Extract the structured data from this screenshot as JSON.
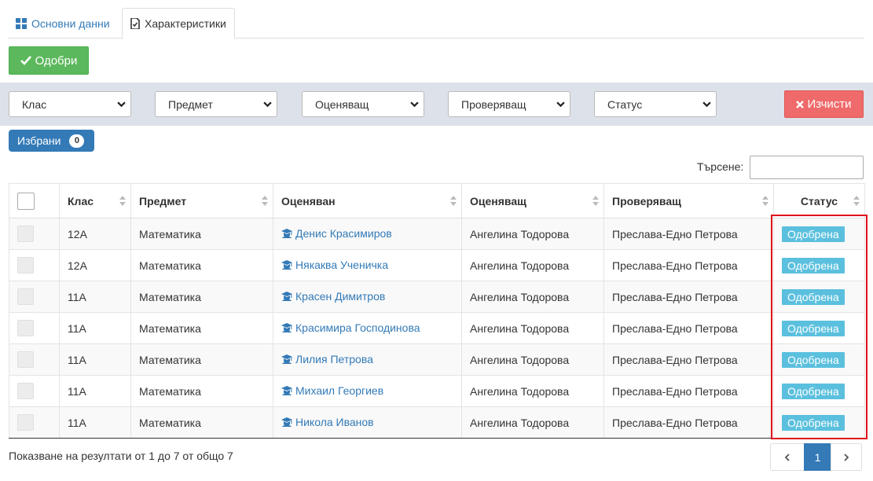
{
  "tabs": [
    {
      "label": "Основни данни",
      "icon": "grid-icon"
    },
    {
      "label": "Характеристики",
      "icon": "document-icon"
    }
  ],
  "toolbar": {
    "approve_label": "Одобри"
  },
  "filters": {
    "class": "Клас",
    "subject": "Предмет",
    "evaluator": "Оценяващ",
    "checker": "Проверяващ",
    "status": "Статус",
    "clear_label": "Изчисти"
  },
  "selected": {
    "label": "Избрани",
    "count": "0"
  },
  "search": {
    "label": "Търсене:",
    "value": ""
  },
  "table": {
    "headers": [
      "Клас",
      "Предмет",
      "Оценяван",
      "Оценяващ",
      "Проверяващ",
      "Статус"
    ],
    "rows": [
      {
        "class": "12А",
        "subject": "Математика",
        "student": "Денис Красимиров",
        "evaluator": "Ангелина Тодорова",
        "checker": "Преслава-Едно Петрова",
        "status": "Одобрена"
      },
      {
        "class": "12А",
        "subject": "Математика",
        "student": "Някаква Ученичка",
        "evaluator": "Ангелина Тодорова",
        "checker": "Преслава-Едно Петрова",
        "status": "Одобрена"
      },
      {
        "class": "11А",
        "subject": "Математика",
        "student": "Красен Димитров",
        "evaluator": "Ангелина Тодорова",
        "checker": "Преслава-Едно Петрова",
        "status": "Одобрена"
      },
      {
        "class": "11А",
        "subject": "Математика",
        "student": "Красимира Господинова",
        "evaluator": "Ангелина Тодорова",
        "checker": "Преслава-Едно Петрова",
        "status": "Одобрена"
      },
      {
        "class": "11А",
        "subject": "Математика",
        "student": "Лилия Петрова",
        "evaluator": "Ангелина Тодорова",
        "checker": "Преслава-Едно Петрова",
        "status": "Одобрена"
      },
      {
        "class": "11А",
        "subject": "Математика",
        "student": "Михаил Георгиев",
        "evaluator": "Ангелина Тодорова",
        "checker": "Преслава-Едно Петрова",
        "status": "Одобрена"
      },
      {
        "class": "11А",
        "subject": "Математика",
        "student": "Никола Иванов",
        "evaluator": "Ангелина Тодорова",
        "checker": "Преслава-Едно Петрова",
        "status": "Одобрена"
      }
    ]
  },
  "footer": {
    "summary": "Показване на резултати от 1 до 7 от общо 7",
    "current_page": "1"
  },
  "colors": {
    "approve": "#5cb85c",
    "clear": "#ef6a6a",
    "primary": "#337ab7",
    "status_badge": "#5bc0de",
    "highlight": "#e0101a",
    "filter_bar": "#dde1e9"
  }
}
